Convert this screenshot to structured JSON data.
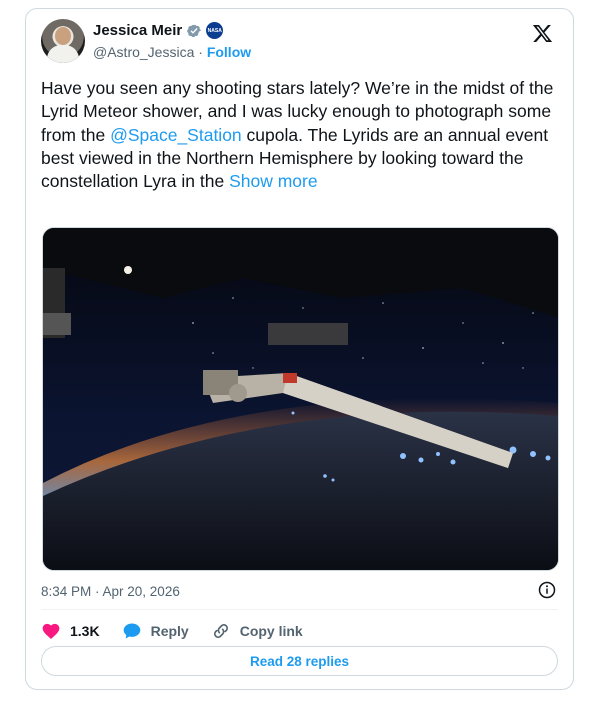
{
  "author": {
    "name": "Jessica Meir",
    "handle": "@Astro_Jessica",
    "separator": "·",
    "follow_label": "Follow",
    "nasa_badge": "NASA"
  },
  "tweet": {
    "text_before": "Have you seen any shooting stars lately? We’re in the midst of the Lyrid Meteor shower, and I was lucky enough to photograph some from the ",
    "mention": "@Space_Station",
    "text_after": " cupola. The Lyrids are an annual event best viewed in the Northern Hemisphere by looking toward the constellation Lyra in the ",
    "show_more": "Show more"
  },
  "timestamp": "8:34 PM · Apr 20, 2026",
  "actions": {
    "like_count": "1.3K",
    "reply_label": "Reply",
    "copy_link_label": "Copy link"
  },
  "read_replies_label": "Read 28 replies",
  "colors": {
    "accent": "#1d9bf0",
    "like": "#f91880",
    "text": "#0f1419",
    "muted": "#536471"
  },
  "icons": [
    "verified-badge-icon",
    "nasa-logo-icon",
    "x-logo-icon",
    "info-icon",
    "heart-icon",
    "reply-bubble-icon",
    "link-icon"
  ]
}
